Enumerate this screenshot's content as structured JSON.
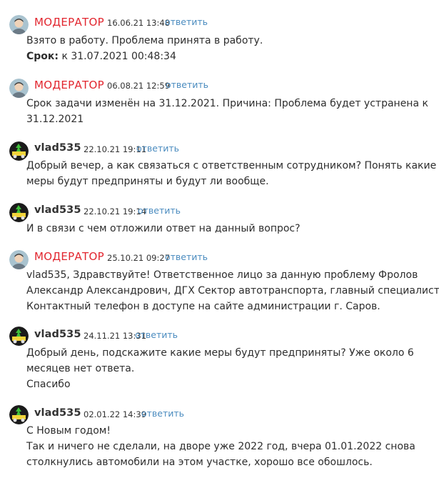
{
  "comments": [
    {
      "author": "МОДЕРАТОР",
      "role": "moderator",
      "timestamp": "16.06.21 13:48",
      "reply_label": "ответить",
      "lines": [
        "Взято в работу. Проблема принята в работу."
      ],
      "deadline_label": "Срок:",
      "deadline_value": " к 31.07.2021 00:48:34"
    },
    {
      "author": "МОДЕРАТОР",
      "role": "moderator",
      "timestamp": "06.08.21 12:59",
      "reply_label": "ответить",
      "lines": [
        "Срок задачи изменён на 31.12.2021. Причина: Проблема будет устранена к",
        "31.12.2021"
      ]
    },
    {
      "author": "vlad535",
      "role": "user",
      "timestamp": "22.10.21 19:11",
      "reply_label": "ответить",
      "lines": [
        "Добрый вечер, а как связаться с ответственным сотрудником? Понять какие",
        "меры будут предприняты и будут ли вообще."
      ]
    },
    {
      "author": "vlad535",
      "role": "user",
      "timestamp": "22.10.21 19:14",
      "reply_label": "ответить",
      "lines": [
        "И в связи с чем отложили ответ на данный вопрос?"
      ]
    },
    {
      "author": "МОДЕРАТОР",
      "role": "moderator",
      "timestamp": "25.10.21 09:27",
      "reply_label": "ответить",
      "lines": [
        "vlad535, Здравствуйте! Ответственное лицо за данную проблему Фролов",
        "Александр Александрович, ДГХ Сектор автотранспорта, главный специалист.",
        "Контактный телефон в доступе на сайте администрации г. Саров."
      ]
    },
    {
      "author": "vlad535",
      "role": "user",
      "timestamp": "24.11.21 13:31",
      "reply_label": "ответить",
      "lines": [
        "Добрый день, подскажите какие меры будут предприняты? Уже около 6",
        "месяцев нет ответа.",
        "Спасибо"
      ]
    },
    {
      "author": "vlad535",
      "role": "user",
      "timestamp": "02.01.22 14:39",
      "reply_label": "ответить",
      "lines": [
        "С Новым годом!",
        "Так и ничего не сделали, на дворе уже 2022 год, вчера 01.01.2022 снова",
        "столкнулись автомобили на этом участке, хорошо все обошлось."
      ]
    }
  ],
  "colors": {
    "moderator_name": "#e2262f",
    "reply_link": "#4a8bbf",
    "text": "#2d2d2d"
  },
  "icons": {
    "moderator_avatar": "moderator-avatar-icon",
    "user_avatar": "user-avatar-icon"
  }
}
